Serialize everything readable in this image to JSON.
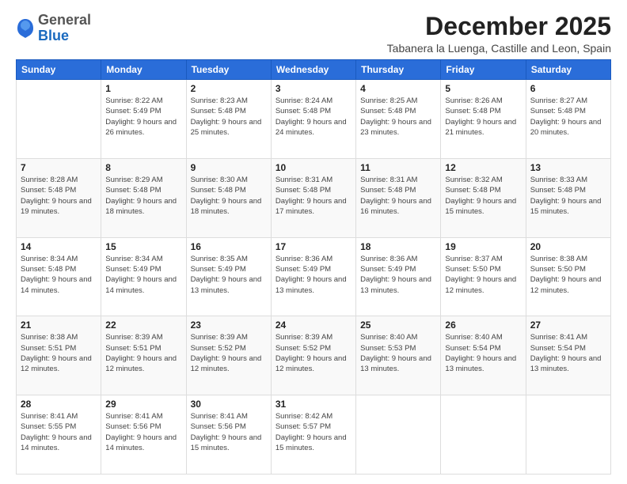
{
  "logo": {
    "general": "General",
    "blue": "Blue"
  },
  "header": {
    "month_year": "December 2025",
    "location": "Tabanera la Luenga, Castille and Leon, Spain"
  },
  "weekdays": [
    "Sunday",
    "Monday",
    "Tuesday",
    "Wednesday",
    "Thursday",
    "Friday",
    "Saturday"
  ],
  "weeks": [
    [
      {
        "day": "",
        "sunrise": "",
        "sunset": "",
        "daylight": ""
      },
      {
        "day": "1",
        "sunrise": "Sunrise: 8:22 AM",
        "sunset": "Sunset: 5:49 PM",
        "daylight": "Daylight: 9 hours and 26 minutes."
      },
      {
        "day": "2",
        "sunrise": "Sunrise: 8:23 AM",
        "sunset": "Sunset: 5:48 PM",
        "daylight": "Daylight: 9 hours and 25 minutes."
      },
      {
        "day": "3",
        "sunrise": "Sunrise: 8:24 AM",
        "sunset": "Sunset: 5:48 PM",
        "daylight": "Daylight: 9 hours and 24 minutes."
      },
      {
        "day": "4",
        "sunrise": "Sunrise: 8:25 AM",
        "sunset": "Sunset: 5:48 PM",
        "daylight": "Daylight: 9 hours and 23 minutes."
      },
      {
        "day": "5",
        "sunrise": "Sunrise: 8:26 AM",
        "sunset": "Sunset: 5:48 PM",
        "daylight": "Daylight: 9 hours and 21 minutes."
      },
      {
        "day": "6",
        "sunrise": "Sunrise: 8:27 AM",
        "sunset": "Sunset: 5:48 PM",
        "daylight": "Daylight: 9 hours and 20 minutes."
      }
    ],
    [
      {
        "day": "7",
        "sunrise": "Sunrise: 8:28 AM",
        "sunset": "Sunset: 5:48 PM",
        "daylight": "Daylight: 9 hours and 19 minutes."
      },
      {
        "day": "8",
        "sunrise": "Sunrise: 8:29 AM",
        "sunset": "Sunset: 5:48 PM",
        "daylight": "Daylight: 9 hours and 18 minutes."
      },
      {
        "day": "9",
        "sunrise": "Sunrise: 8:30 AM",
        "sunset": "Sunset: 5:48 PM",
        "daylight": "Daylight: 9 hours and 18 minutes."
      },
      {
        "day": "10",
        "sunrise": "Sunrise: 8:31 AM",
        "sunset": "Sunset: 5:48 PM",
        "daylight": "Daylight: 9 hours and 17 minutes."
      },
      {
        "day": "11",
        "sunrise": "Sunrise: 8:31 AM",
        "sunset": "Sunset: 5:48 PM",
        "daylight": "Daylight: 9 hours and 16 minutes."
      },
      {
        "day": "12",
        "sunrise": "Sunrise: 8:32 AM",
        "sunset": "Sunset: 5:48 PM",
        "daylight": "Daylight: 9 hours and 15 minutes."
      },
      {
        "day": "13",
        "sunrise": "Sunrise: 8:33 AM",
        "sunset": "Sunset: 5:48 PM",
        "daylight": "Daylight: 9 hours and 15 minutes."
      }
    ],
    [
      {
        "day": "14",
        "sunrise": "Sunrise: 8:34 AM",
        "sunset": "Sunset: 5:48 PM",
        "daylight": "Daylight: 9 hours and 14 minutes."
      },
      {
        "day": "15",
        "sunrise": "Sunrise: 8:34 AM",
        "sunset": "Sunset: 5:49 PM",
        "daylight": "Daylight: 9 hours and 14 minutes."
      },
      {
        "day": "16",
        "sunrise": "Sunrise: 8:35 AM",
        "sunset": "Sunset: 5:49 PM",
        "daylight": "Daylight: 9 hours and 13 minutes."
      },
      {
        "day": "17",
        "sunrise": "Sunrise: 8:36 AM",
        "sunset": "Sunset: 5:49 PM",
        "daylight": "Daylight: 9 hours and 13 minutes."
      },
      {
        "day": "18",
        "sunrise": "Sunrise: 8:36 AM",
        "sunset": "Sunset: 5:49 PM",
        "daylight": "Daylight: 9 hours and 13 minutes."
      },
      {
        "day": "19",
        "sunrise": "Sunrise: 8:37 AM",
        "sunset": "Sunset: 5:50 PM",
        "daylight": "Daylight: 9 hours and 12 minutes."
      },
      {
        "day": "20",
        "sunrise": "Sunrise: 8:38 AM",
        "sunset": "Sunset: 5:50 PM",
        "daylight": "Daylight: 9 hours and 12 minutes."
      }
    ],
    [
      {
        "day": "21",
        "sunrise": "Sunrise: 8:38 AM",
        "sunset": "Sunset: 5:51 PM",
        "daylight": "Daylight: 9 hours and 12 minutes."
      },
      {
        "day": "22",
        "sunrise": "Sunrise: 8:39 AM",
        "sunset": "Sunset: 5:51 PM",
        "daylight": "Daylight: 9 hours and 12 minutes."
      },
      {
        "day": "23",
        "sunrise": "Sunrise: 8:39 AM",
        "sunset": "Sunset: 5:52 PM",
        "daylight": "Daylight: 9 hours and 12 minutes."
      },
      {
        "day": "24",
        "sunrise": "Sunrise: 8:39 AM",
        "sunset": "Sunset: 5:52 PM",
        "daylight": "Daylight: 9 hours and 12 minutes."
      },
      {
        "day": "25",
        "sunrise": "Sunrise: 8:40 AM",
        "sunset": "Sunset: 5:53 PM",
        "daylight": "Daylight: 9 hours and 13 minutes."
      },
      {
        "day": "26",
        "sunrise": "Sunrise: 8:40 AM",
        "sunset": "Sunset: 5:54 PM",
        "daylight": "Daylight: 9 hours and 13 minutes."
      },
      {
        "day": "27",
        "sunrise": "Sunrise: 8:41 AM",
        "sunset": "Sunset: 5:54 PM",
        "daylight": "Daylight: 9 hours and 13 minutes."
      }
    ],
    [
      {
        "day": "28",
        "sunrise": "Sunrise: 8:41 AM",
        "sunset": "Sunset: 5:55 PM",
        "daylight": "Daylight: 9 hours and 14 minutes."
      },
      {
        "day": "29",
        "sunrise": "Sunrise: 8:41 AM",
        "sunset": "Sunset: 5:56 PM",
        "daylight": "Daylight: 9 hours and 14 minutes."
      },
      {
        "day": "30",
        "sunrise": "Sunrise: 8:41 AM",
        "sunset": "Sunset: 5:56 PM",
        "daylight": "Daylight: 9 hours and 15 minutes."
      },
      {
        "day": "31",
        "sunrise": "Sunrise: 8:42 AM",
        "sunset": "Sunset: 5:57 PM",
        "daylight": "Daylight: 9 hours and 15 minutes."
      },
      {
        "day": "",
        "sunrise": "",
        "sunset": "",
        "daylight": ""
      },
      {
        "day": "",
        "sunrise": "",
        "sunset": "",
        "daylight": ""
      },
      {
        "day": "",
        "sunrise": "",
        "sunset": "",
        "daylight": ""
      }
    ]
  ]
}
